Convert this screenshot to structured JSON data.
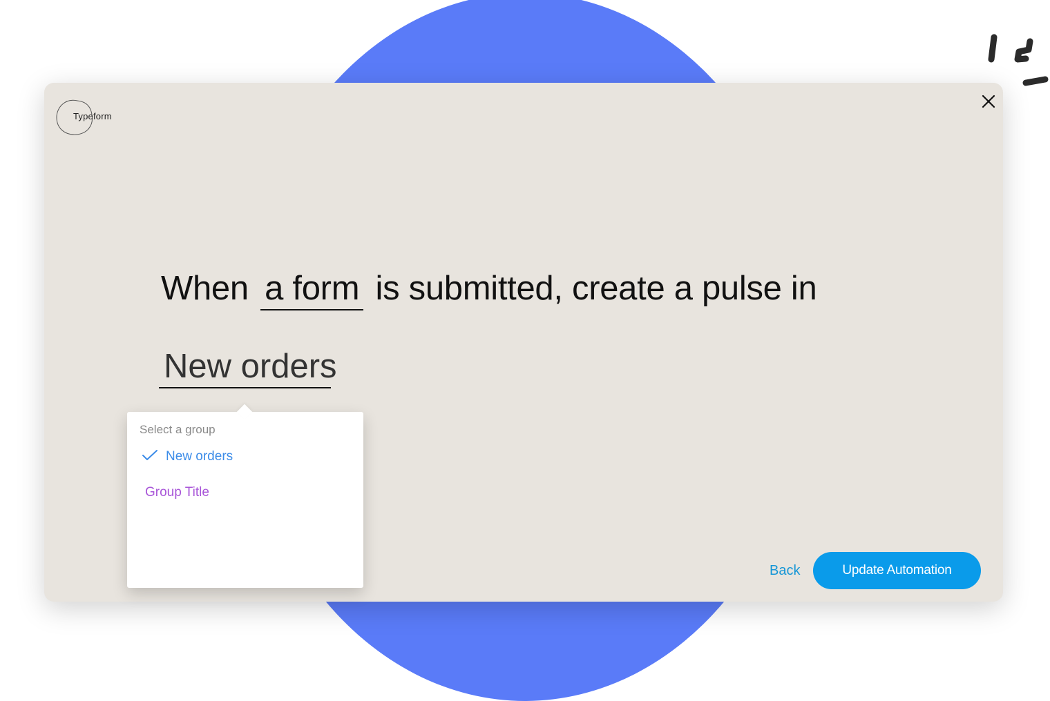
{
  "colors": {
    "background_circle": "#5a7bf8",
    "card": "#e8e4de",
    "selected_option": "#3c8ce8",
    "group_title_option": "#a855d8",
    "primary_button": "#0a9bea",
    "back_link": "#1596d6"
  },
  "brand": {
    "logo_text": "Typeform"
  },
  "header": {
    "close_icon": "close-icon"
  },
  "recipe": {
    "prefix": "When",
    "trigger_slot": "a form",
    "middle": "is submitted, create a pulse in",
    "group_value": "New orders"
  },
  "dropdown": {
    "label": "Select a group",
    "options": [
      {
        "label": "New orders",
        "selected": true,
        "icon": "check-icon"
      },
      {
        "label": "Group Title",
        "selected": false
      }
    ]
  },
  "footer": {
    "back_label": "Back",
    "update_label": "Update Automation"
  }
}
